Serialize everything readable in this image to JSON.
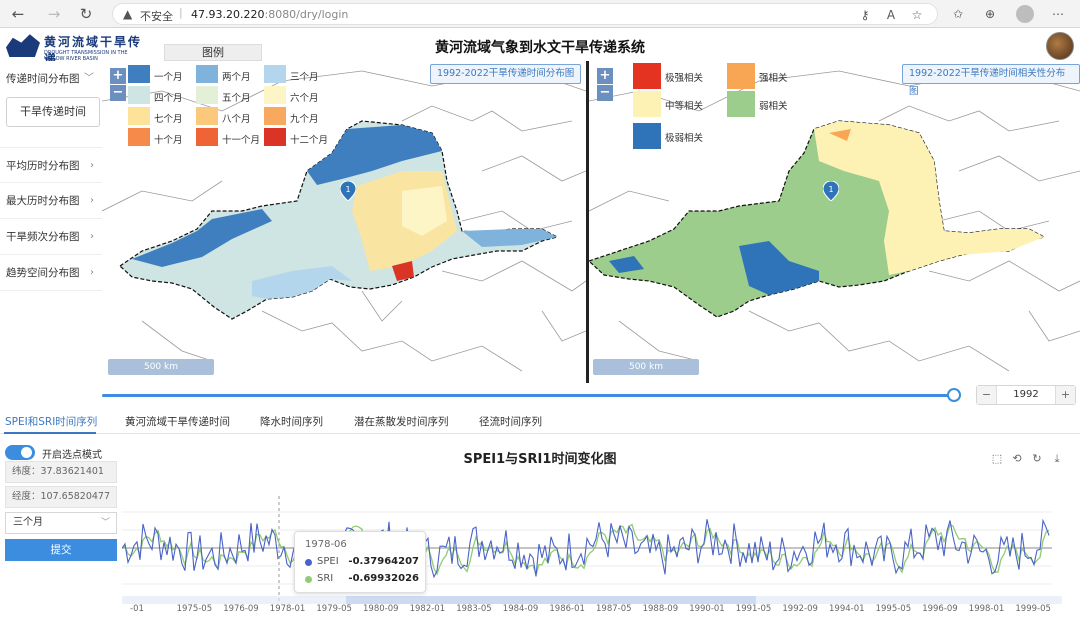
{
  "browser": {
    "security": "不安全",
    "url_host": "47.93.20.220",
    "url_rest": ":8080/dry/login"
  },
  "header": {
    "logo_title": "黄河流域干旱传递",
    "logo_subtitle": "DROUGHT TRANSMISSION IN THE YELLOW RIVER BASIN",
    "title": "黄河流域气象到水文干旱传递系统",
    "legend_tab": "图例"
  },
  "sidebar": {
    "items": [
      {
        "label": "传递时间分布图",
        "chevron": "﹀"
      },
      {
        "label": "平均历时分布图",
        "chevron": "›"
      },
      {
        "label": "最大历时分布图",
        "chevron": "›"
      },
      {
        "label": "干旱频次分布图",
        "chevron": "›"
      },
      {
        "label": "趋势空间分布图",
        "chevron": "›"
      }
    ],
    "sub_button": "干旱传递时间"
  },
  "map_left": {
    "badge": "1992-2022干旱传递时间分布图",
    "scale": "500 km",
    "legend": [
      {
        "label": "一个月",
        "color": "#3f7fc0"
      },
      {
        "label": "两个月",
        "color": "#7fb3dc"
      },
      {
        "label": "三个月",
        "color": "#b4d6ec"
      },
      {
        "label": "四个月",
        "color": "#cfe5e3"
      },
      {
        "label": "五个月",
        "color": "#e3efd6"
      },
      {
        "label": "六个月",
        "color": "#fdf5c6"
      },
      {
        "label": "七个月",
        "color": "#fde39a"
      },
      {
        "label": "八个月",
        "color": "#fcc97c"
      },
      {
        "label": "九个月",
        "color": "#f9a860"
      },
      {
        "label": "十个月",
        "color": "#f58a4a"
      },
      {
        "label": "十一个月",
        "color": "#ee6436"
      },
      {
        "label": "十二个月",
        "color": "#d93425"
      }
    ]
  },
  "map_right": {
    "badge": "1992-2022干旱传递时间相关性分布图",
    "scale": "500 km",
    "legend": [
      {
        "label": "极强相关",
        "color": "#e53322"
      },
      {
        "label": "强相关",
        "color": "#f8a653"
      },
      {
        "label": "中等相关",
        "color": "#fdf2b4"
      },
      {
        "label": "弱相关",
        "color": "#9ccd8c"
      },
      {
        "label": "极弱相关",
        "color": "#2f73b8"
      }
    ]
  },
  "year_stepper": {
    "value": "1992",
    "minus": "−",
    "plus": "+"
  },
  "tabs": [
    "SPEI和SRI时间序列",
    "黄河流域干旱传递时间",
    "降水时间序列",
    "潜在蒸散发时间序列",
    "径流时间序列"
  ],
  "controls": {
    "toggle_label": "开启选点模式",
    "lat": "纬度：37.83621401",
    "lon": "经度：107.65820477",
    "select_value": "三个月",
    "submit": "提交"
  },
  "chart": {
    "title": "SPEI1与SRI1时间变化图",
    "tooltip": {
      "date": "1978-06",
      "rows": [
        {
          "name": "SPEI",
          "value": "-0.37964207",
          "color": "#4a63c8"
        },
        {
          "name": "SRI",
          "value": "-0.69932026",
          "color": "#91cc75"
        }
      ]
    }
  },
  "chart_data": {
    "type": "line",
    "title": "SPEI1与SRI1时间变化图",
    "x_tick_labels": [
      "-01",
      "1975-05",
      "1976-09",
      "1978-01",
      "1979-05",
      "1980-09",
      "1982-01",
      "1983-05",
      "1984-09",
      "1986-01",
      "1987-05",
      "1988-09",
      "1990-01",
      "1991-05",
      "1992-09",
      "1994-01",
      "1995-05",
      "1996-09",
      "1998-01",
      "1999-05"
    ],
    "series": [
      {
        "name": "SPEI",
        "color": "#4a63c8"
      },
      {
        "name": "SRI",
        "color": "#91cc75"
      }
    ],
    "highlight": {
      "x": "1978-06",
      "SPEI": -0.37964207,
      "SRI": -0.69932026
    },
    "ylim": [
      -2.5,
      2.5
    ]
  }
}
